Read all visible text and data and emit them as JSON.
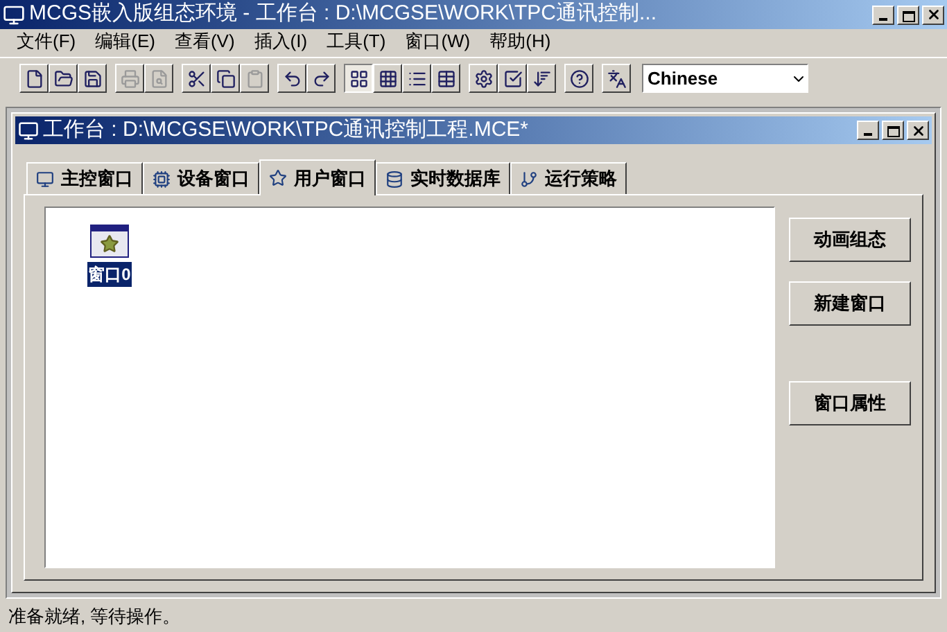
{
  "window": {
    "title": "MCGS嵌入版组态环境 - 工作台 : D:\\MCGSE\\WORK\\TPC通讯控制..."
  },
  "menu": [
    "文件(F)",
    "编辑(E)",
    "查看(V)",
    "插入(I)",
    "工具(T)",
    "窗口(W)",
    "帮助(H)"
  ],
  "toolbar": [
    [
      {
        "kind": "new",
        "disabled": false
      },
      {
        "kind": "open",
        "disabled": false
      },
      {
        "kind": "save",
        "disabled": false
      }
    ],
    [
      {
        "kind": "print",
        "disabled": true
      },
      {
        "kind": "preview",
        "disabled": true
      }
    ],
    [
      {
        "kind": "cut",
        "disabled": false
      },
      {
        "kind": "copy",
        "disabled": false
      },
      {
        "kind": "paste",
        "disabled": true
      }
    ],
    [
      {
        "kind": "undo",
        "disabled": false
      },
      {
        "kind": "redo",
        "disabled": false
      }
    ],
    [
      {
        "kind": "large-icons",
        "disabled": false
      },
      {
        "kind": "small-icons",
        "disabled": false
      },
      {
        "kind": "list",
        "disabled": false
      },
      {
        "kind": "details",
        "disabled": false
      }
    ],
    [
      {
        "kind": "properties",
        "disabled": false
      },
      {
        "kind": "check",
        "disabled": false
      },
      {
        "kind": "sort",
        "disabled": false
      }
    ],
    [
      {
        "kind": "help",
        "disabled": false
      }
    ],
    [
      {
        "kind": "language",
        "disabled": false
      }
    ]
  ],
  "view_mode": [
    {
      "selected": true
    },
    {
      "selected": false
    },
    {
      "selected": false
    },
    {
      "selected": false
    }
  ],
  "language_select": {
    "value": "Chinese"
  },
  "workspace": {
    "title": "工作台 : D:\\MCGSE\\WORK\\TPC通讯控制工程.MCE*",
    "tabs": [
      {
        "label": "主控窗口",
        "kind": "main",
        "selected": false
      },
      {
        "label": "设备窗口",
        "kind": "device",
        "selected": false
      },
      {
        "label": "用户窗口",
        "kind": "user",
        "selected": true
      },
      {
        "label": "实时数据库",
        "kind": "database",
        "selected": false
      },
      {
        "label": "运行策略",
        "kind": "strategy",
        "selected": false
      }
    ],
    "items": [
      {
        "label": "窗口0",
        "selected": true
      }
    ],
    "buttons": [
      "动画组态",
      "新建窗口",
      "窗口属性"
    ]
  },
  "status_bar": "准备就绪, 等待操作。"
}
